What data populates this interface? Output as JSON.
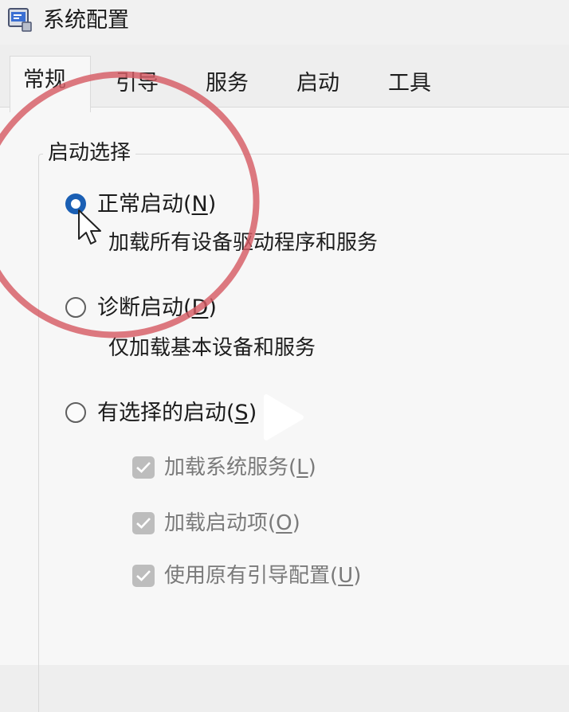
{
  "window": {
    "title": "系统配置",
    "icon": "msconfig-app-icon"
  },
  "tabs": [
    {
      "label": "常规",
      "active": true
    },
    {
      "label": "引导",
      "active": false
    },
    {
      "label": "服务",
      "active": false
    },
    {
      "label": "启动",
      "active": false
    },
    {
      "label": "工具",
      "active": false
    }
  ],
  "startup_selection": {
    "group_label": "启动选择",
    "options": [
      {
        "label": "正常启动(",
        "mnemonic": "N",
        "suffix": ")",
        "description": "加载所有设备驱动程序和服务",
        "selected": true
      },
      {
        "label": "诊断启动(",
        "mnemonic": "D",
        "suffix": ")",
        "description": "仅加载基本设备和服务",
        "selected": false
      },
      {
        "label": "有选择的启动(",
        "mnemonic": "S",
        "suffix": ")",
        "description": "",
        "selected": false
      }
    ],
    "selective_items": [
      {
        "label": "加载系统服务(",
        "mnemonic": "L",
        "suffix": ")",
        "checked": true,
        "disabled": true
      },
      {
        "label": "加载启动项(",
        "mnemonic": "O",
        "suffix": ")",
        "checked": true,
        "disabled": true
      },
      {
        "label": "使用原有引导配置(",
        "mnemonic": "U",
        "suffix": ")",
        "checked": true,
        "disabled": true
      }
    ]
  },
  "colors": {
    "radio_selected": "#1a5fb4",
    "highlight_circle": "#d65c64",
    "checkbox_disabled": "#bdbdbd"
  }
}
